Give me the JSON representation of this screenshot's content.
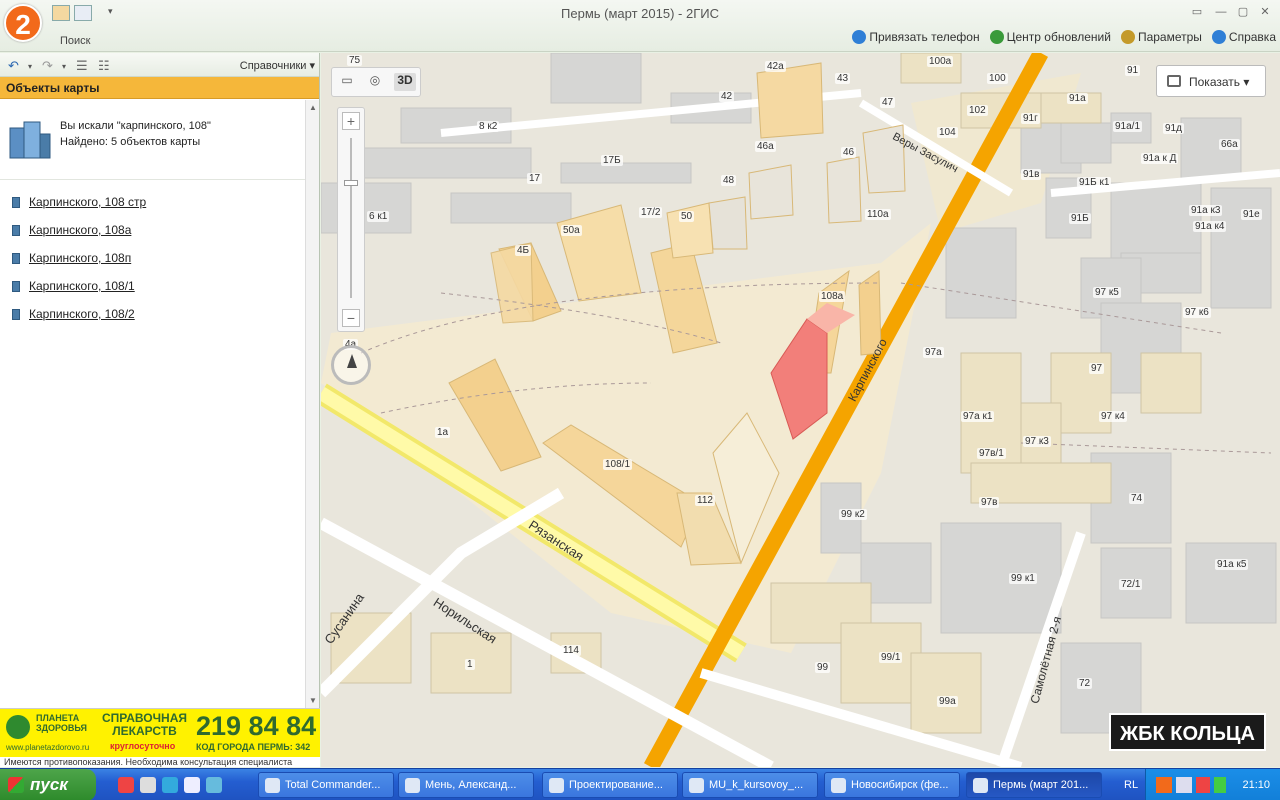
{
  "window": {
    "title": "Пермь (март 2015)  - 2ГИС",
    "logo_text": "2",
    "search_tab": "Поиск",
    "controls": [
      "▭",
      "—",
      "▢",
      "✕"
    ]
  },
  "top_links": [
    {
      "label": "Привязать телефон",
      "color": "#2f7fd6"
    },
    {
      "label": "Центр обновлений",
      "color": "#3a9a3a"
    },
    {
      "label": "Параметры",
      "color": "#c49a2a"
    },
    {
      "label": "Справка",
      "color": "#2f7fd6"
    }
  ],
  "left_panel": {
    "directories_label": "Справочники",
    "header": "Объекты карты",
    "search_query": "Вы искали \"карпинского, 108\"",
    "found": "Найдено: 5 объектов карты",
    "results": [
      "Карпинского, 108 стр",
      "Карпинского, 108а",
      "Карпинского, 108п",
      "Карпинского, 108/1",
      "Карпинского, 108/2"
    ]
  },
  "ad": {
    "brand": "ПЛАНЕТА\nЗДОРОВЬЯ",
    "url": "www.planetazdorovo.ru",
    "service": "СПРАВОЧНАЯ\nЛЕКАРСТВ",
    "hours": "круглосуточно",
    "phone": "219 84 84",
    "code": "КОД ГОРОДА ПЕРМЬ: 342",
    "note": "Имеются противопоказания. Необходима консультация специалиста"
  },
  "map": {
    "mode_3d": "3D",
    "zoom_in": "+",
    "zoom_out": "−",
    "show_button": "Показать",
    "banner": "ЖБК КОЛЬЦА",
    "streets": {
      "karpinskogo": "Карпинского",
      "ryazanskaya": "Рязанская",
      "norilskaya": "Норильская",
      "susanina": "Сусанина",
      "very_zasulich": "Веры Засулич",
      "samoletnaya": "Самолётная 2-я"
    },
    "labels": [
      "75",
      "42а",
      "43",
      "100а",
      "91",
      "100",
      "42",
      "47",
      "102",
      "104",
      "91г",
      "91а",
      "91а/1",
      "91д",
      "66а",
      "8 к2",
      "46а",
      "46",
      "91в",
      "91а к Д",
      "17Б",
      "17",
      "48",
      "91Б к1",
      "91а к3",
      "91а к4",
      "91е",
      "17/2",
      "50",
      "50а",
      "110а",
      "91Б",
      "4Б",
      "6 к1",
      "108а",
      "97 к5",
      "97 к6",
      "97а",
      "97",
      "4а",
      "97а к1",
      "97 к4",
      "97 к3",
      "1а",
      "97в/1",
      "108/1",
      "74",
      "112",
      "97в",
      "99 к2",
      "99 к1",
      "72/1",
      "91а к5",
      "114",
      "1",
      "99",
      "99/1",
      "72",
      "99а"
    ]
  },
  "taskbar": {
    "start": "пуск",
    "buttons": [
      "Total Commander...",
      "Мень, Александ...",
      "Проектирование...",
      "MU_k_kursovoy_...",
      "Новосибирск (фе...",
      "Пермь (март 201..."
    ],
    "active_index": 5,
    "lang": "RL",
    "clock": "21:10"
  }
}
